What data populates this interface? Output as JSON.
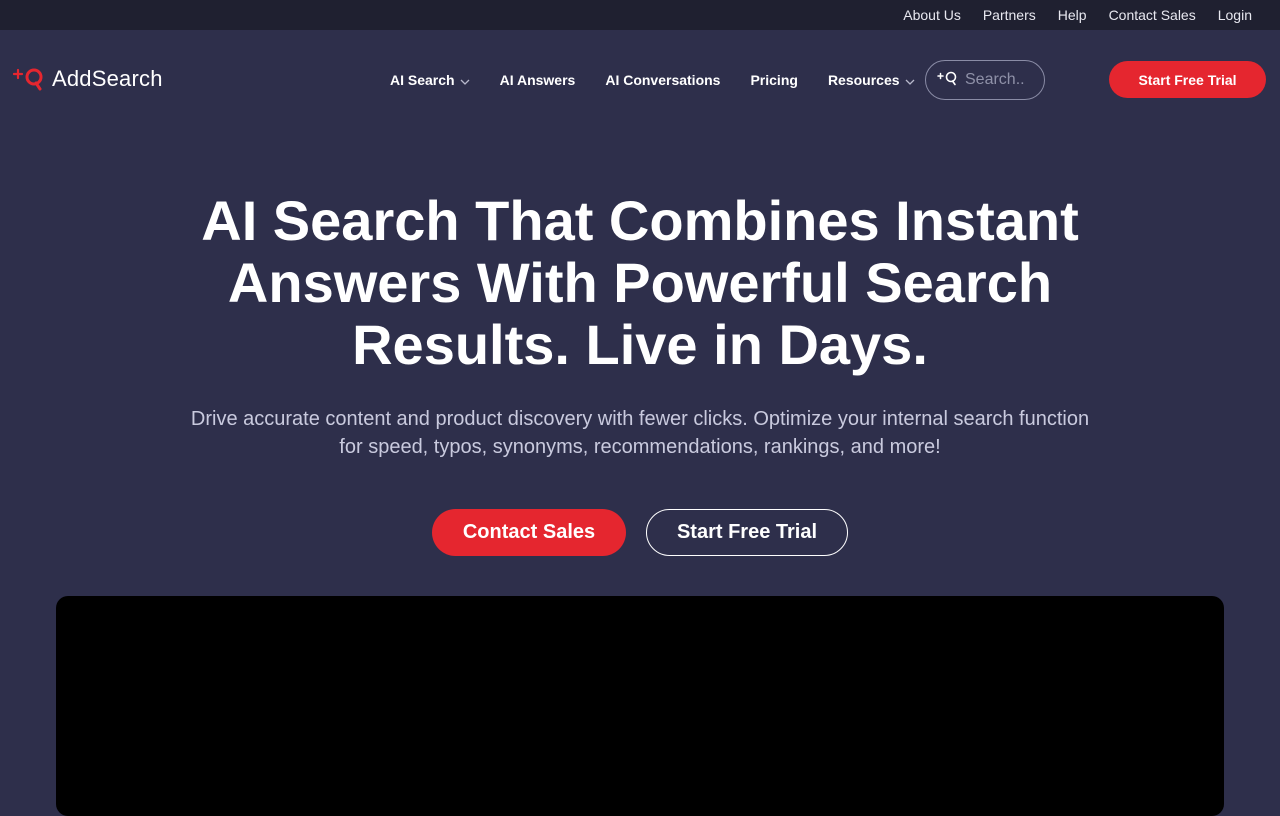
{
  "topbar": {
    "links": [
      "About Us",
      "Partners",
      "Help",
      "Contact Sales",
      "Login"
    ]
  },
  "brand": {
    "name": "AddSearch",
    "accent_color": "#e5262f",
    "logo_icon": "plus-magnifier-icon"
  },
  "nav": {
    "items": [
      {
        "label": "AI Search",
        "dropdown": true
      },
      {
        "label": "AI Answers",
        "dropdown": false
      },
      {
        "label": "AI Conversations",
        "dropdown": false
      },
      {
        "label": "Pricing",
        "dropdown": false
      },
      {
        "label": "Resources",
        "dropdown": true
      }
    ],
    "search_placeholder": "Search..",
    "trial_label": "Start Free Trial"
  },
  "hero": {
    "title": "AI Search That Combines Instant Answers With Powerful Search Results. Live in Days.",
    "subtitle": "Drive accurate content and product discovery with fewer clicks. Optimize your internal search function for speed, typos, synonyms, recommendations, rankings, and more!",
    "cta_primary": "Contact Sales",
    "cta_secondary": "Start Free Trial"
  },
  "colors": {
    "background": "#2e2f4b",
    "topbar": "#1f2030",
    "video": "#000000"
  }
}
